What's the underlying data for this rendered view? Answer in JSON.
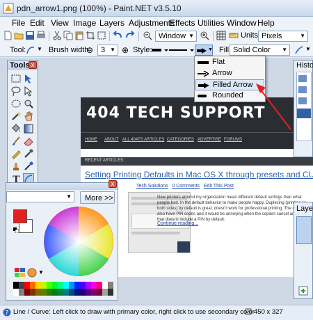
{
  "window": {
    "title": "pdn_arrow1.png (100%) - Paint.NET v3.5.10"
  },
  "menu": [
    "File",
    "Edit",
    "View",
    "Image",
    "Layers",
    "Adjustments",
    "Effects",
    "Utilities",
    "Window",
    "Help"
  ],
  "toolbar1": {
    "zoom_value": "Window",
    "units_label": "Units:",
    "units_value": "Pixels"
  },
  "toolbar2": {
    "tool_label": "Tool:",
    "brush_width_label": "Brush width:",
    "brush_width_value": "3",
    "style_label": "Style:",
    "fill_label": "Fill:",
    "fill_value": "Solid Color"
  },
  "arrow_dropdown": {
    "items": [
      "Flat",
      "Arrow",
      "Filled Arrow",
      "Rounded"
    ],
    "highlighted": "Filled Arrow"
  },
  "tools_window": {
    "title": "Tools"
  },
  "history_window": {
    "title": "Histo"
  },
  "layers_window": {
    "title": "Laye"
  },
  "colors_window": {
    "more_button": "More >>"
  },
  "annotation": {
    "arrow_color": "#e32020"
  },
  "document": {
    "site_title": "404 TECH SUPPORT",
    "nav": [
      "HOME",
      "ABOUT",
      "ALL 404TS ARTICLES",
      "CATEGORIES",
      "ADVERTISE",
      "FORUMS"
    ],
    "section_label": "RECENT ARTICLES:",
    "article_title": "Setting Printing Defaults in Mac OS X through presets and CUPS",
    "meta_category": "Tech Solutions",
    "meta_comments": "0 Comments",
    "meta_edit": "Edit This Post",
    "body": "New printers around my organization mean different default settings than what people had. In the default behavior to make people happy. Duplexing (printing on both sides) by default is great, doesn't work for professional printing. The copiers also have PIN codes and it would be annoying when the copiers cancel any job that doesn't include a PIN by default.",
    "continue": "Continue reading..."
  },
  "status": {
    "text": "Line / Curve: Left click to draw with primary color, right click to use secondary color",
    "size": "450 x 327"
  }
}
